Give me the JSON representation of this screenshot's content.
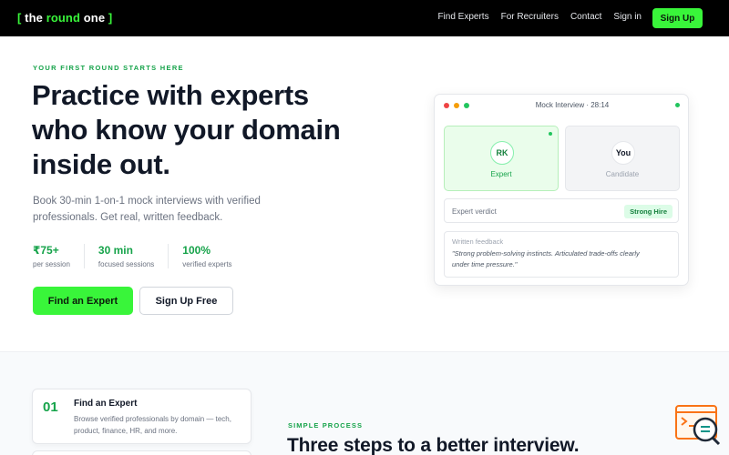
{
  "nav": {
    "logo": {
      "open": "[",
      "word1": "the",
      "word2": "round",
      "word3": "one",
      "close": "]"
    },
    "links": [
      "Find Experts",
      "For Recruiters",
      "Contact",
      "Sign in"
    ],
    "signup": "Sign Up"
  },
  "hero": {
    "eyebrow": "YOUR FIRST ROUND STARTS HERE",
    "title_lines": [
      "Practice with experts",
      "who know your domain",
      "inside out."
    ],
    "subtitle_lines": [
      "Book 30-min 1-on-1 mock interviews with verified",
      "professionals. Get real, written feedback."
    ],
    "stats": [
      {
        "value": "₹75+",
        "label": "per session"
      },
      {
        "value": "30 min",
        "label": "focused sessions"
      },
      {
        "value": "100%",
        "label": "verified experts"
      }
    ],
    "primary_button": "Find an Expert",
    "secondary_button": "Sign Up Free"
  },
  "mock_card": {
    "title": "Mock Interview · 28:14",
    "expert": {
      "initials": "RK",
      "label": "Expert"
    },
    "candidate": {
      "initials": "You",
      "label": "Candidate"
    },
    "verdict_label": "Expert verdict",
    "verdict_value": "Strong Hire",
    "feedback_label": "Written feedback",
    "feedback_lines": [
      "\"Strong problem-solving instincts. Articulated trade-offs clearly",
      "under time pressure.\""
    ],
    "colors": {
      "dot_red": "#ef4444",
      "dot_yellow": "#f59e0b",
      "dot_green": "#22c55e"
    }
  },
  "steps": [
    {
      "number": "01",
      "title": "Find an Expert",
      "desc_lines": [
        "Browse verified professionals by domain — tech,",
        "product, finance, HR, and more."
      ]
    }
  ],
  "process": {
    "eyebrow": "SIMPLE PROCESS",
    "title": "Three steps to a better interview."
  },
  "widget": {
    "icon": "support-chat-search-icon"
  },
  "colors": {
    "accent": "#39f53a",
    "accent_text": "#16a34a",
    "nav_bg": "#000000"
  }
}
